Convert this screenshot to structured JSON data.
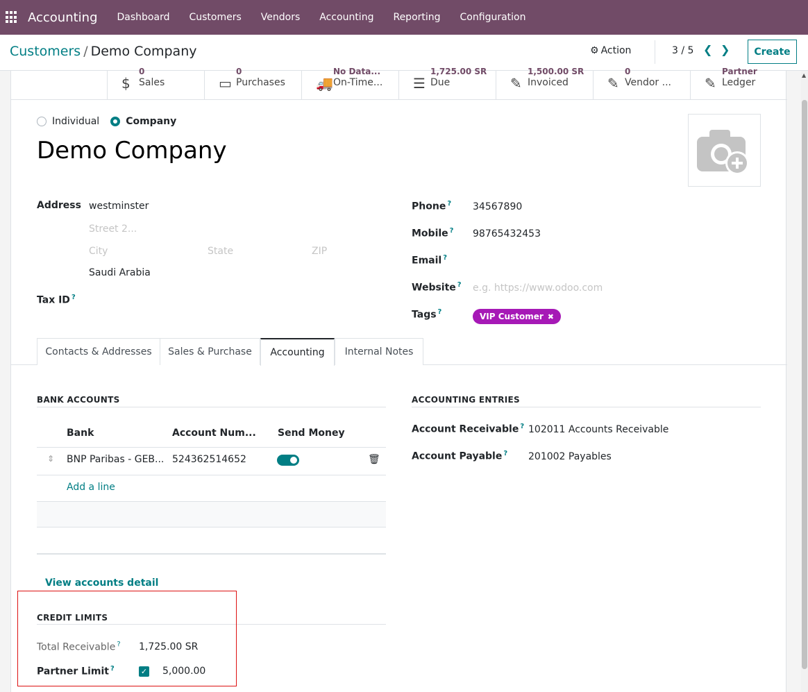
{
  "topnav": {
    "app_name": "Accounting",
    "menu": [
      "Dashboard",
      "Customers",
      "Vendors",
      "Accounting",
      "Reporting",
      "Configuration"
    ]
  },
  "control_panel": {
    "breadcrumb_parent": "Customers",
    "breadcrumb_separator": "/",
    "breadcrumb_current": "Demo Company",
    "action_label": "Action",
    "pager": "3 / 5",
    "create_label": "Create"
  },
  "smart_buttons": [
    {
      "icon": "dollar-icon",
      "glyph": "$",
      "value": "0",
      "label": "Sales"
    },
    {
      "icon": "credit-card-icon",
      "glyph": "▭",
      "value": "0",
      "label": "Purchases"
    },
    {
      "icon": "truck-icon",
      "glyph": "🚚",
      "value": "No Data...",
      "label": "On-Time..."
    },
    {
      "icon": "list-icon",
      "glyph": "☰",
      "value": "1,725.00 SR",
      "label": "Due"
    },
    {
      "icon": "pencil-square-icon",
      "glyph": "✎",
      "value": "1,500.00 SR",
      "label": "Invoiced"
    },
    {
      "icon": "pencil-square-icon",
      "glyph": "✎",
      "value": "0",
      "label": "Vendor ..."
    },
    {
      "icon": "pencil-square-icon",
      "glyph": "✎",
      "value": "Partner",
      "label": "Ledger"
    }
  ],
  "partner": {
    "type_individual": "Individual",
    "type_company": "Company",
    "name": "Demo Company"
  },
  "address": {
    "label": "Address",
    "street": "westminster",
    "street2_placeholder": "Street 2...",
    "city_placeholder": "City",
    "state_placeholder": "State",
    "zip_placeholder": "ZIP",
    "country": "Saudi Arabia",
    "tax_id_label": "Tax ID"
  },
  "contact": {
    "phone_label": "Phone",
    "phone": "34567890",
    "mobile_label": "Mobile",
    "mobile": "98765432453",
    "email_label": "Email",
    "website_label": "Website",
    "website_placeholder": "e.g. https://www.odoo.com",
    "tags_label": "Tags",
    "tag": "VIP Customer"
  },
  "help_mark": "?",
  "tabs": [
    "Contacts & Addresses",
    "Sales & Purchase",
    "Accounting",
    "Internal Notes"
  ],
  "bank_accounts": {
    "title": "BANK ACCOUNTS",
    "columns": [
      "Bank",
      "Account Num...",
      "Send Money"
    ],
    "row": {
      "bank": "BNP Paribas - GEB...",
      "account": "524362514652"
    },
    "add_line": "Add a line"
  },
  "accounting_entries": {
    "title": "ACCOUNTING ENTRIES",
    "receivable_label": "Account Receivable",
    "receivable_value": "102011 Accounts Receivable",
    "payable_label": "Account Payable",
    "payable_value": "201002 Payables"
  },
  "view_accounts_detail": "View accounts detail",
  "credit_limits": {
    "title": "CREDIT LIMITS",
    "total_receivable_label": "Total Receivable",
    "total_receivable_value": "1,725.00 SR",
    "partner_limit_label": "Partner Limit",
    "partner_limit_value": "5,000.00"
  }
}
